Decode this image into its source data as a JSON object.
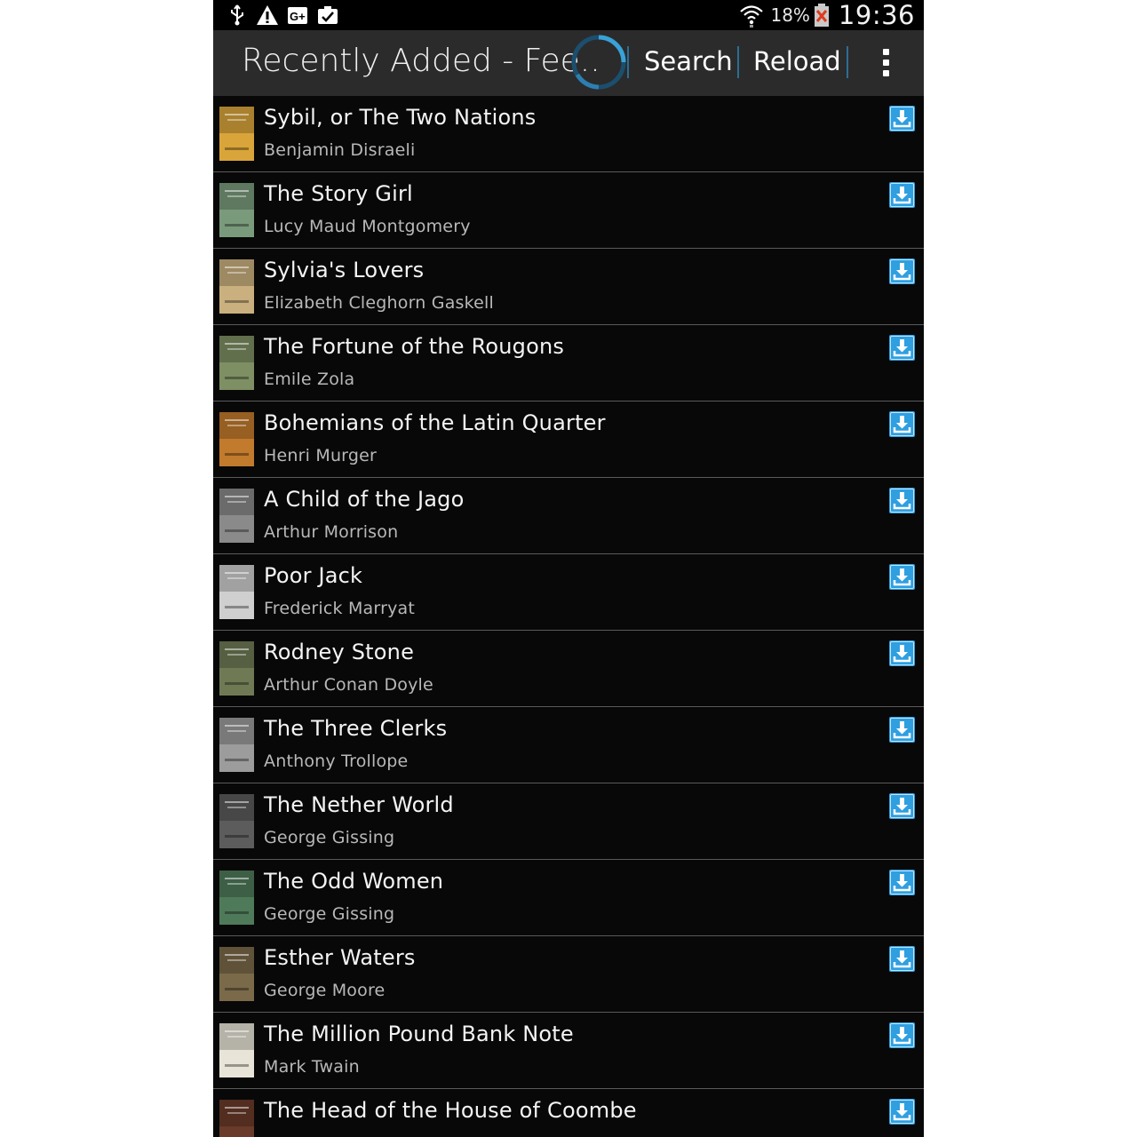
{
  "status_bar": {
    "icons": [
      "usb-icon",
      "warning-icon",
      "google-plus-icon",
      "clipboard-check-icon",
      "wifi-icon",
      "battery-low-icon"
    ],
    "battery_percent": "18%",
    "time": "19:36"
  },
  "action_bar": {
    "title": "Recently Added - Fee..",
    "search_label": "Search",
    "reload_label": "Reload",
    "accent_color": "#2a6f95"
  },
  "books": [
    {
      "title": "Sybil, or The Two Nations",
      "author": "Benjamin Disraeli",
      "cover_color": "#d9a53a"
    },
    {
      "title": "The Story Girl",
      "author": "Lucy Maud Montgomery",
      "cover_color": "#7a9a7c"
    },
    {
      "title": "Sylvia's Lovers",
      "author": "Elizabeth Cleghorn Gaskell",
      "cover_color": "#c9b07e"
    },
    {
      "title": "The Fortune of the Rougons",
      "author": "Emile Zola",
      "cover_color": "#7e8f63"
    },
    {
      "title": "Bohemians of the Latin Quarter",
      "author": "Henri Murger",
      "cover_color": "#c27a2c"
    },
    {
      "title": "A Child of the Jago",
      "author": "Arthur Morrison",
      "cover_color": "#8a8a8a"
    },
    {
      "title": "Poor Jack",
      "author": "Frederick Marryat",
      "cover_color": "#cfcfcf"
    },
    {
      "title": "Rodney Stone",
      "author": "Arthur Conan Doyle",
      "cover_color": "#6f7a55"
    },
    {
      "title": "The Three Clerks",
      "author": "Anthony Trollope",
      "cover_color": "#9c9c9c"
    },
    {
      "title": "The Nether World",
      "author": "George Gissing",
      "cover_color": "#5c5c5c"
    },
    {
      "title": "The Odd Women",
      "author": "George Gissing",
      "cover_color": "#4f7a5a"
    },
    {
      "title": "Esther Waters",
      "author": "George Moore",
      "cover_color": "#7a6a4a"
    },
    {
      "title": "The Million Pound Bank Note",
      "author": "Mark Twain",
      "cover_color": "#e8e4d8"
    },
    {
      "title": "The Head of the House of Coombe",
      "author": "",
      "cover_color": "#6a3a2a"
    }
  ]
}
